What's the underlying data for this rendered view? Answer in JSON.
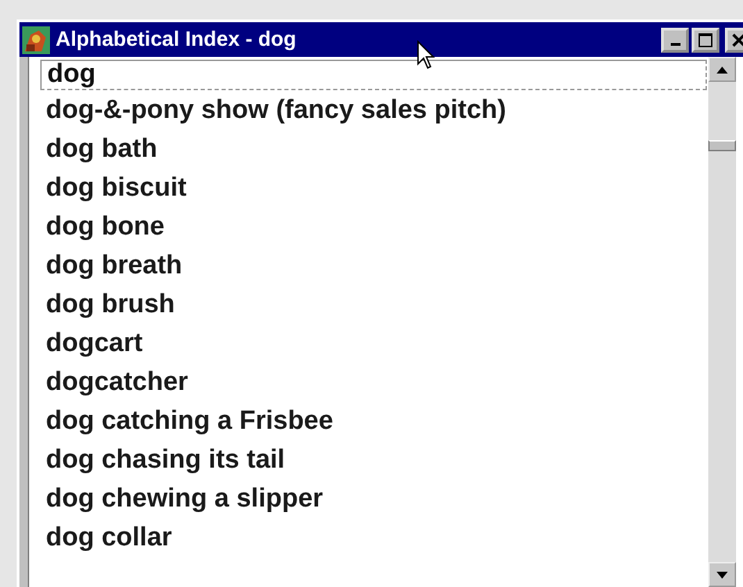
{
  "window": {
    "title": "Alphabetical Index - dog"
  },
  "search": {
    "value": "dog"
  },
  "items": [
    {
      "label": "dog-&-pony show (fancy sales pitch)"
    },
    {
      "label": "dog bath"
    },
    {
      "label": "dog biscuit"
    },
    {
      "label": "dog bone"
    },
    {
      "label": "dog breath"
    },
    {
      "label": "dog brush"
    },
    {
      "label": "dogcart"
    },
    {
      "label": "dogcatcher"
    },
    {
      "label": "dog catching a Frisbee"
    },
    {
      "label": "dog chasing its tail"
    },
    {
      "label": "dog chewing a slipper"
    },
    {
      "label": "dog collar"
    }
  ]
}
